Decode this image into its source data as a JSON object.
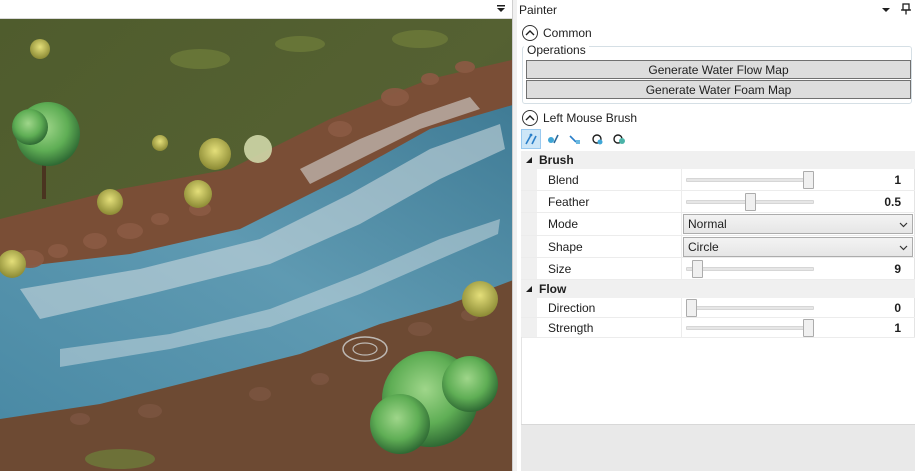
{
  "viewport": {
    "menu_icon": "dropdown-menu-icon"
  },
  "panel": {
    "title": "Painter",
    "common": {
      "label": "Common",
      "expanded": true
    },
    "operations": {
      "legend": "Operations",
      "buttons": [
        "Generate Water Flow Map",
        "Generate Water Foam Map"
      ]
    },
    "brush_section": {
      "label": "Left Mouse Brush",
      "expanded": true
    },
    "tools": [
      {
        "name": "flow-brush-tool-icon",
        "active": true
      },
      {
        "name": "foam-brush-tool-icon",
        "active": false
      },
      {
        "name": "smooth-tool-icon",
        "active": false
      },
      {
        "name": "erase-tool-icon",
        "active": false
      },
      {
        "name": "mix-tool-icon",
        "active": false
      }
    ],
    "grid": {
      "brush": {
        "label": "Brush",
        "blend": {
          "label": "Blend",
          "value": "1",
          "fraction": 1.0
        },
        "feather": {
          "label": "Feather",
          "value": "0.5",
          "fraction": 0.5
        },
        "mode": {
          "label": "Mode",
          "value": "Normal"
        },
        "shape": {
          "label": "Shape",
          "value": "Circle"
        },
        "size": {
          "label": "Size",
          "value": "9",
          "fraction": 0.05
        }
      },
      "flow": {
        "label": "Flow",
        "direction": {
          "label": "Direction",
          "value": "0",
          "fraction": 0.0
        },
        "strength": {
          "label": "Strength",
          "value": "1",
          "fraction": 1.0
        }
      }
    }
  },
  "colors": {
    "water": "#4f8aa3",
    "foam": "#d9e4e6",
    "grass": "#4b5a2a",
    "mud": "#7a4e36",
    "tool_active": "#cde6f7"
  }
}
